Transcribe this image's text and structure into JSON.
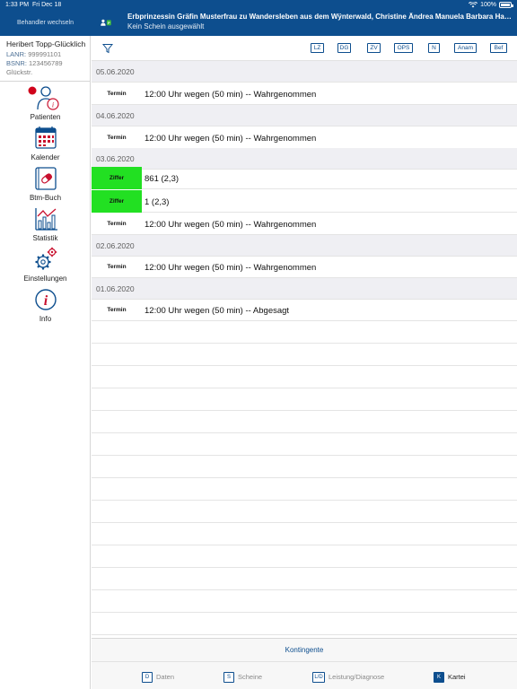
{
  "status_bar": {
    "time": "1:33 PM",
    "date": "Fri Dec 18",
    "battery": "100%"
  },
  "header": {
    "switch_practitioner": "Behandler wechseln",
    "patient_name": "Erbprinzessin Gräfin Musterfrau zu Wandersleben aus dem Wÿnterwald, Christine Ändrea Manuela Barbara Hanna Bi...",
    "schein_status": "Kein Schein ausgewählt"
  },
  "sidebar": {
    "practitioner": {
      "name": "Heribert Topp-Glücklich",
      "lanr_label": "LANR:",
      "lanr": "999991101",
      "bsnr_label": "BSNR:",
      "bsnr": "123456789",
      "street": "Glückstr."
    },
    "items": [
      {
        "label": "Patienten"
      },
      {
        "label": "Kalender"
      },
      {
        "label": "Btm-Buch"
      },
      {
        "label": "Statistik"
      },
      {
        "label": "Einstellungen"
      },
      {
        "label": "Info"
      }
    ]
  },
  "toolbar": {
    "buttons": [
      "LZ",
      "DG",
      "ZV",
      "OPS",
      "N",
      "Anam",
      "Bef"
    ]
  },
  "list": {
    "groups": [
      {
        "date": "05.06.2020",
        "entries": [
          {
            "tag": "Termin",
            "text": "12:00 Uhr wegen (50 min) -- Wahrgenommen",
            "highlight": false
          }
        ]
      },
      {
        "date": "04.06.2020",
        "entries": [
          {
            "tag": "Termin",
            "text": "12:00 Uhr wegen (50 min) -- Wahrgenommen",
            "highlight": false
          }
        ]
      },
      {
        "date": "03.06.2020",
        "entries": [
          {
            "tag": "Ziffer",
            "text": "861 (2,3)",
            "highlight": true
          },
          {
            "tag": "Ziffer",
            "text": "1 (2,3)",
            "highlight": true
          },
          {
            "tag": "Termin",
            "text": "12:00 Uhr wegen (50 min) -- Wahrgenommen",
            "highlight": false
          }
        ]
      },
      {
        "date": "02.06.2020",
        "entries": [
          {
            "tag": "Termin",
            "text": "12:00 Uhr wegen (50 min) -- Wahrgenommen",
            "highlight": false
          }
        ]
      },
      {
        "date": "01.06.2020",
        "entries": [
          {
            "tag": "Termin",
            "text": "12:00 Uhr wegen (50 min) -- Abgesagt",
            "highlight": false
          }
        ]
      }
    ]
  },
  "footer": {
    "kontingente": "Kontingente",
    "tabs": [
      {
        "key": "D",
        "label": "Daten",
        "active": false
      },
      {
        "key": "S",
        "label": "Scheine",
        "active": false
      },
      {
        "key": "L/D",
        "label": "Leistung/Diagnose",
        "active": false
      },
      {
        "key": "K",
        "label": "Kartei",
        "active": true
      }
    ]
  },
  "colors": {
    "brand": "#0d4e8e",
    "highlight": "#22e022",
    "notification": "#d0021b",
    "icon_red": "#c8102e"
  }
}
